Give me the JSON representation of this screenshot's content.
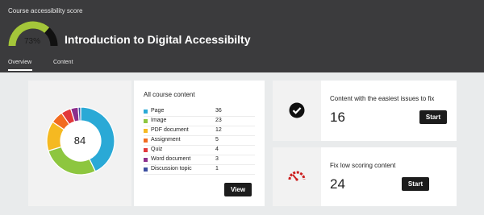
{
  "header": {
    "app_label": "Course accessibility score",
    "score_percent": 73,
    "score_label": "73%",
    "course_title": "Introduction to Digital Accessibilty",
    "colors": {
      "gauge": "#a4c63a",
      "background": "#3b3b3d"
    }
  },
  "tabs": [
    {
      "label": "Overview",
      "active": true
    },
    {
      "label": "Content",
      "active": false
    }
  ],
  "summary": {
    "title": "All course content",
    "total": "84",
    "items": [
      {
        "label": "Page",
        "count": "36",
        "color": "#2aa9d6"
      },
      {
        "label": "Image",
        "count": "23",
        "color": "#8dc63f"
      },
      {
        "label": "PDF document",
        "count": "12",
        "color": "#f5b921"
      },
      {
        "label": "Assignment",
        "count": "5",
        "color": "#f26b1f"
      },
      {
        "label": "Quiz",
        "count": "4",
        "color": "#e2373a"
      },
      {
        "label": "Word document",
        "count": "3",
        "color": "#8c2e8c"
      },
      {
        "label": "Discussion topic",
        "count": "1",
        "color": "#3b4fa0"
      }
    ],
    "view_label": "View"
  },
  "cards": [
    {
      "title": "Content with the easiest issues to fix",
      "count": "16",
      "button": "Start",
      "icon": "check-circle-icon"
    },
    {
      "title": "Fix low scoring content",
      "count": "24",
      "button": "Start",
      "icon": "speedometer-low-icon"
    }
  ]
}
